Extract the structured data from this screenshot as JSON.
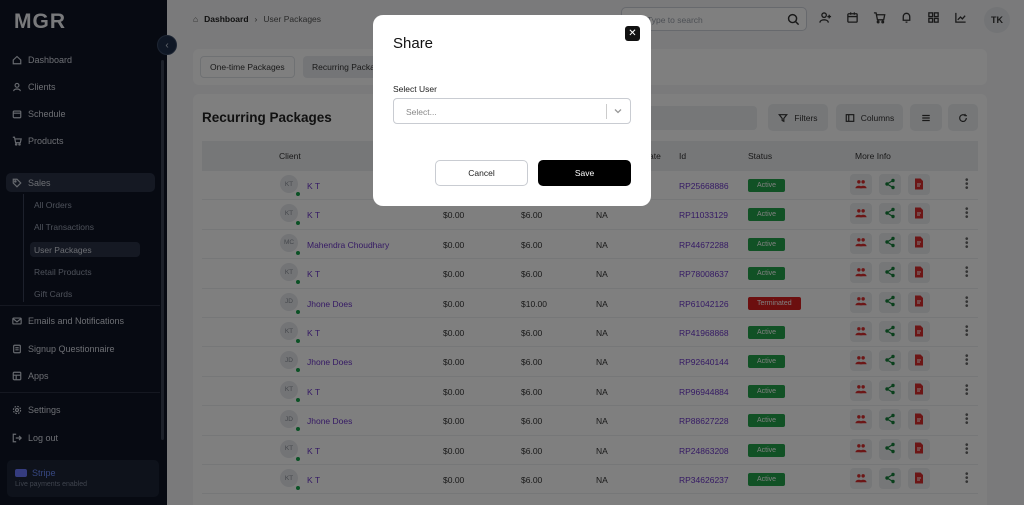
{
  "app": {
    "logo": "MGR"
  },
  "sidebar": {
    "items": [
      {
        "label": "Dashboard",
        "icon": "home-icon"
      },
      {
        "label": "Clients",
        "icon": "user-icon"
      },
      {
        "label": "Schedule",
        "icon": "calendar-icon"
      },
      {
        "label": "Products",
        "icon": "cart-icon"
      },
      {
        "label": "Sales",
        "icon": "tag-icon"
      },
      {
        "label": "Emails and Notifications",
        "icon": "mail-icon"
      },
      {
        "label": "Signup Questionnaire",
        "icon": "form-icon"
      },
      {
        "label": "Apps",
        "icon": "apps-icon"
      },
      {
        "label": "Settings",
        "icon": "gear-icon"
      },
      {
        "label": "Log out",
        "icon": "logout-icon"
      }
    ],
    "sales_sub": [
      "All Orders",
      "All Transactions",
      "User Packages",
      "Retail Products",
      "Gift Cards"
    ],
    "stripe": {
      "title": "Stripe",
      "subtitle": "Live payments enabled"
    }
  },
  "header": {
    "breadcrumb": {
      "root": "Dashboard",
      "current": "User Packages"
    },
    "search_placeholder": "Type to search",
    "avatar": "TK"
  },
  "tabs": [
    "One-time Packages",
    "Recurring Packages"
  ],
  "card": {
    "title": "Recurring Packages",
    "filters_label": "Filters",
    "columns_label": "Columns"
  },
  "table": {
    "headers": {
      "client": "Client",
      "date_partial": "ate",
      "id": "Id",
      "status": "Status",
      "more": "More Info"
    },
    "rows": [
      {
        "initials": "KT",
        "client": "K T",
        "c2": "",
        "c3": "",
        "c4": "",
        "id": "RP25668886",
        "status": "Active"
      },
      {
        "initials": "KT",
        "client": "K T",
        "c2": "$0.00",
        "c3": "$6.00",
        "c4": "NA",
        "id": "RP11033129",
        "status": "Active"
      },
      {
        "initials": "MC",
        "client": "Mahendra Choudhary",
        "c2": "$0.00",
        "c3": "$6.00",
        "c4": "NA",
        "id": "RP44672288",
        "status": "Active"
      },
      {
        "initials": "KT",
        "client": "K T",
        "c2": "$0.00",
        "c3": "$6.00",
        "c4": "NA",
        "id": "RP78008637",
        "status": "Active"
      },
      {
        "initials": "JD",
        "client": "Jhone Does",
        "c2": "$0.00",
        "c3": "$10.00",
        "c4": "NA",
        "id": "RP61042126",
        "status": "Terminated"
      },
      {
        "initials": "KT",
        "client": "K T",
        "c2": "$0.00",
        "c3": "$6.00",
        "c4": "NA",
        "id": "RP41968868",
        "status": "Active"
      },
      {
        "initials": "JD",
        "client": "Jhone Does",
        "c2": "$0.00",
        "c3": "$6.00",
        "c4": "NA",
        "id": "RP92640144",
        "status": "Active"
      },
      {
        "initials": "KT",
        "client": "K T",
        "c2": "$0.00",
        "c3": "$6.00",
        "c4": "NA",
        "id": "RP96944884",
        "status": "Active"
      },
      {
        "initials": "JD",
        "client": "Jhone Does",
        "c2": "$0.00",
        "c3": "$6.00",
        "c4": "NA",
        "id": "RP88627228",
        "status": "Active"
      },
      {
        "initials": "KT",
        "client": "K T",
        "c2": "$0.00",
        "c3": "$6.00",
        "c4": "NA",
        "id": "RP24863208",
        "status": "Active"
      },
      {
        "initials": "KT",
        "client": "K T",
        "c2": "$0.00",
        "c3": "$6.00",
        "c4": "NA",
        "id": "RP34626237",
        "status": "Active"
      }
    ]
  },
  "modal": {
    "title": "Share",
    "field_label": "Select User",
    "select_placeholder": "Select...",
    "cancel_label": "Cancel",
    "save_label": "Save"
  },
  "colors": {
    "active": "#22a34a",
    "terminated": "#d91f1f",
    "link": "#6b35c8",
    "sidebar": "#0f1524",
    "icon_red": "#d92c2c",
    "icon_green": "#16803a"
  }
}
